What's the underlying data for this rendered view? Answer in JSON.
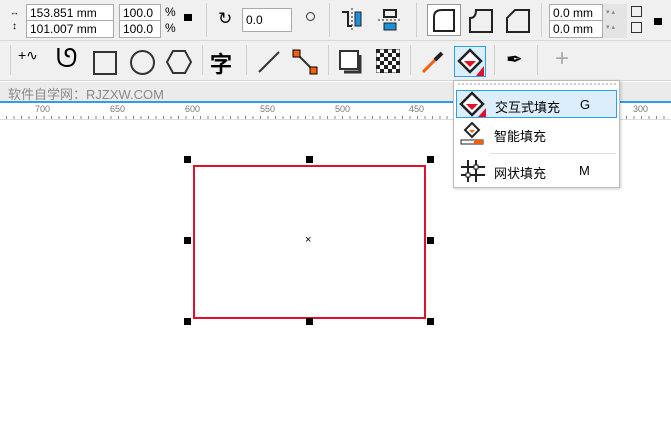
{
  "property_bar": {
    "width": "153.851 mm",
    "height": "101.007 mm",
    "scale_x": "100.0",
    "scale_y": "100.0",
    "percent": "%",
    "rotation": "0.0",
    "corner_h": "0.0 mm",
    "corner_v": "0.0 mm"
  },
  "watermark": "软件自学网：RJZXW.COM",
  "ruler": {
    "labels": [
      "700",
      "650",
      "600",
      "550",
      "500",
      "450",
      "300"
    ]
  },
  "flyout": {
    "items": [
      {
        "label": "交互式填充",
        "shortcut": "G"
      },
      {
        "label": "智能填充",
        "shortcut": ""
      },
      {
        "label": "网状填充",
        "shortcut": "M"
      }
    ]
  },
  "colors": {
    "selection": "#e0102a",
    "accent": "#2aa0e8"
  }
}
